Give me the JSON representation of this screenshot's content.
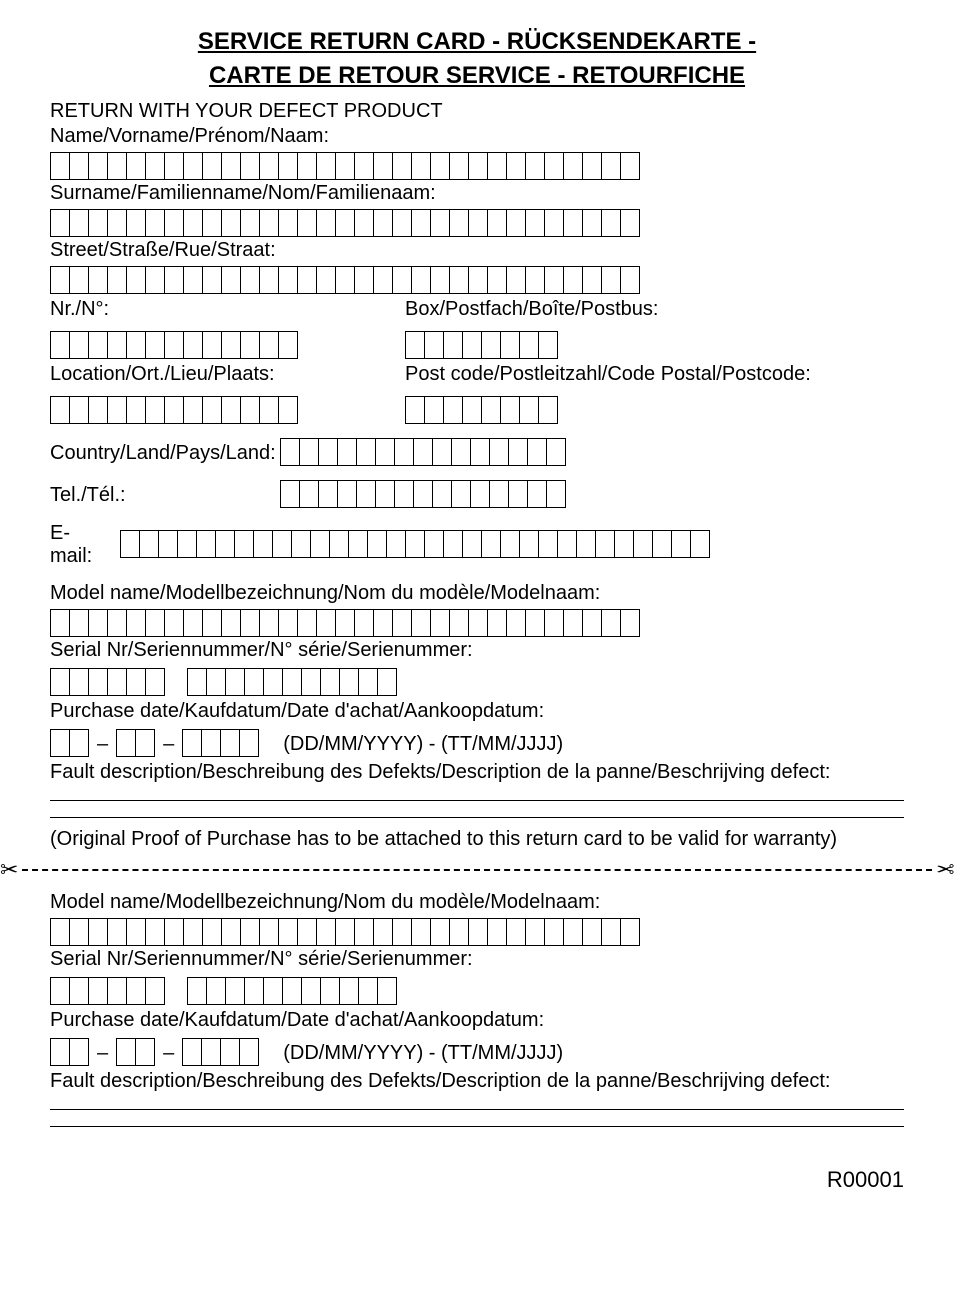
{
  "title_line1": "SERVICE RETURN CARD - RÜCKSENDEKARTE -",
  "title_line2": "CARTE DE RETOUR SERVICE - RETOURFICHE",
  "subtitle": "RETURN WITH YOUR DEFECT PRODUCT",
  "fields": {
    "name": "Name/Vorname/Prénom/Naam:",
    "surname": "Surname/Familienname/Nom/Familienaam:",
    "street": "Street/Straße/Rue/Straat:",
    "nr": "Nr./N°:",
    "box": "Box/Postfach/Boîte/Postbus:",
    "location": "Location/Ort./Lieu/Plaats:",
    "postcode": "Post code/Postleitzahl/Code Postal/Postcode:",
    "country": "Country/Land/Pays/Land:",
    "tel": "Tel./Tél.:",
    "email": "E-mail:",
    "model": "Model name/Modellbezeichnung/Nom du modèle/Modelnaam:",
    "serial": "Serial Nr/Seriennummer/N° série/Serienummer:",
    "purchase": "Purchase date/Kaufdatum/Date d'achat/Aankoopdatum:",
    "date_hint": "(DD/MM/YYYY) - (TT/MM/JJJJ)",
    "fault": "Fault description/Beschreibung des Defekts/Description de la panne/Beschrijving defect:"
  },
  "proof_note": "(Original Proof of Purchase has to be attached to this return card to be valid for warranty)",
  "footer_code": "R00001",
  "box_counts": {
    "name": 31,
    "surname": 31,
    "street": 31,
    "nr": 13,
    "box": 8,
    "location": 13,
    "postcode": 8,
    "country": 15,
    "tel": 15,
    "email": 31,
    "model": 31,
    "serial_a": 6,
    "serial_b": 11,
    "date_dd": 2,
    "date_mm": 2,
    "date_yyyy": 4
  }
}
